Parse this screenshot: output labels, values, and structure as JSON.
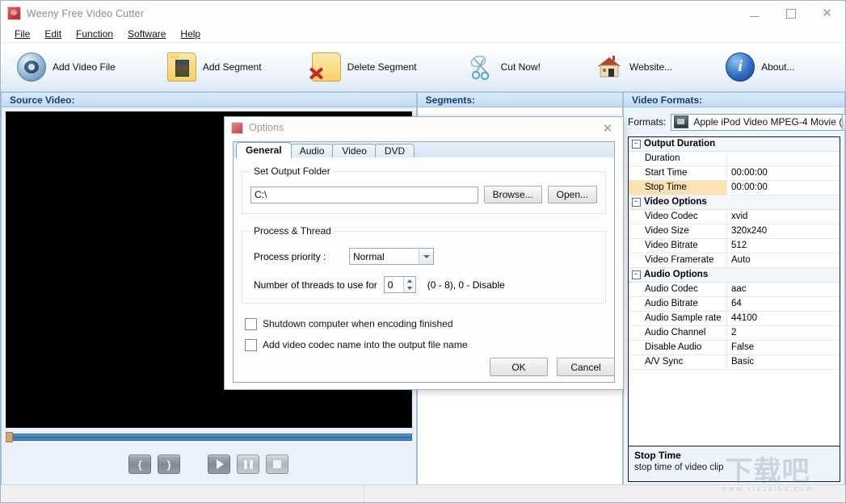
{
  "window": {
    "title": "Weeny Free Video Cutter",
    "icon": "app-icon",
    "minimize": "—",
    "maximize": "□",
    "close": "✕"
  },
  "menu": {
    "items": [
      {
        "label": "File"
      },
      {
        "label": "Edit"
      },
      {
        "label": "Function"
      },
      {
        "label": "Software"
      },
      {
        "label": "Help"
      }
    ]
  },
  "toolbar": {
    "buttons": [
      {
        "label": "Add Video File",
        "icon": "film-reel-icon"
      },
      {
        "label": "Add Segment",
        "icon": "folder-add-segment-icon"
      },
      {
        "label": "Delete Segment",
        "icon": "folder-delete-segment-icon"
      },
      {
        "label": "Cut Now!",
        "icon": "scissors-icon"
      },
      {
        "label": "Website...",
        "icon": "house-icon"
      },
      {
        "label": "About...",
        "icon": "info-icon"
      }
    ]
  },
  "panes": {
    "source": {
      "header": "Source Video:",
      "controls": {
        "mark_in": "{",
        "mark_out": "}",
        "play": "play-icon",
        "pause": "pause-icon",
        "stop": "stop-icon"
      }
    },
    "segments": {
      "header": "Segments:"
    },
    "formats": {
      "header": "Video Formats:",
      "formats_label": "Formats:",
      "selected_format": "Apple iPod Video MPEG-4 Movie (",
      "grid": [
        {
          "type": "category",
          "name": "Output Duration",
          "expander": "−"
        },
        {
          "type": "row",
          "name": "Duration",
          "value": "",
          "selected": false
        },
        {
          "type": "row",
          "name": "Start Time",
          "value": "00:00:00",
          "selected": false
        },
        {
          "type": "row",
          "name": "Stop Time",
          "value": "00:00:00",
          "selected": true
        },
        {
          "type": "category",
          "name": "Video Options",
          "expander": "−"
        },
        {
          "type": "row",
          "name": "Video Codec",
          "value": "xvid",
          "selected": false
        },
        {
          "type": "row",
          "name": "Video Size",
          "value": "320x240",
          "selected": false
        },
        {
          "type": "row",
          "name": "Video Bitrate",
          "value": "512",
          "selected": false
        },
        {
          "type": "row",
          "name": "Video Framerate",
          "value": "Auto",
          "selected": false
        },
        {
          "type": "category",
          "name": "Audio Options",
          "expander": "−"
        },
        {
          "type": "row",
          "name": "Audio Codec",
          "value": "aac",
          "selected": false
        },
        {
          "type": "row",
          "name": "Audio Bitrate",
          "value": "64",
          "selected": false
        },
        {
          "type": "row",
          "name": "Audio Sample rate",
          "value": "44100",
          "selected": false
        },
        {
          "type": "row",
          "name": "Audio Channel",
          "value": "2",
          "selected": false
        },
        {
          "type": "row",
          "name": "Disable Audio",
          "value": "False",
          "selected": false
        },
        {
          "type": "row",
          "name": "A/V Sync",
          "value": "Basic",
          "selected": false
        }
      ],
      "description": {
        "title": "Stop Time",
        "text": "stop time of video clip"
      }
    }
  },
  "dialog": {
    "title": "Options",
    "close": "✕",
    "tabs": [
      {
        "label": "General",
        "active": true
      },
      {
        "label": "Audio",
        "active": false
      },
      {
        "label": "Video",
        "active": false
      },
      {
        "label": "DVD",
        "active": false
      }
    ],
    "output_folder": {
      "legend": "Set Output Folder",
      "value": "C:\\",
      "placeholder": "",
      "browse_label": "Browse...",
      "open_label": "Open..."
    },
    "process_thread": {
      "legend": "Process & Thread",
      "priority_label": "Process priority :",
      "priority_value": "Normal",
      "threads_label": "Number of threads to use for",
      "threads_value": "0",
      "threads_hint": "(0 - 8),  0 - Disable"
    },
    "checkboxes": [
      {
        "label": "Shutdown computer when encoding finished",
        "checked": false
      },
      {
        "label": "Add video codec name into the output file name",
        "checked": false
      }
    ],
    "ok_label": "OK",
    "cancel_label": "Cancel"
  },
  "watermark": {
    "text": "下载吧",
    "url": "www.xiazaiba.com"
  },
  "colors": {
    "pane_header_text": "#15406c",
    "selected_row": "#fce2b0",
    "accent": "#2f6ea8"
  }
}
